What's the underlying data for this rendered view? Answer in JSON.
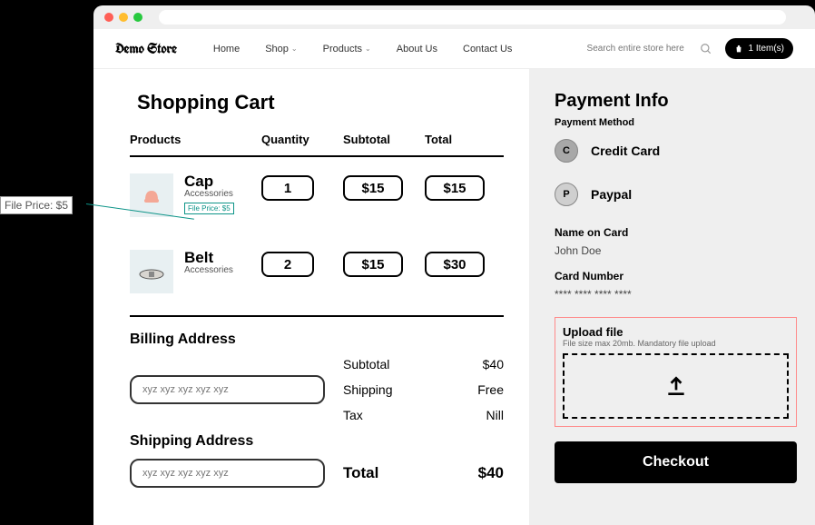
{
  "callout": {
    "label": "File Price: $5"
  },
  "store": {
    "name": "Demo Store"
  },
  "nav": {
    "home": "Home",
    "shop": "Shop",
    "products": "Products",
    "about": "About Us",
    "contact": "Contact Us",
    "search_placeholder": "Search entire store here ..",
    "cart_badge": "1 Item(s)"
  },
  "cart": {
    "title": "Shopping Cart",
    "headers": {
      "products": "Products",
      "quantity": "Quantity",
      "subtotal": "Subtotal",
      "total": "Total"
    },
    "items": [
      {
        "name": "Cap",
        "category": "Accessories",
        "file_price": "File Price: $5",
        "qty": "1",
        "subtotal": "$15",
        "total": "$15"
      },
      {
        "name": "Belt",
        "category": "Accessories",
        "qty": "2",
        "subtotal": "$15",
        "total": "$30"
      }
    ],
    "billing_title": "Billing Address",
    "shipping_title": "Shipping Address",
    "address_placeholder": "xyz xyz xyz xyz xyz",
    "summary": {
      "subtotal_label": "Subtotal",
      "subtotal_value": "$40",
      "shipping_label": "Shipping",
      "shipping_value": "Free",
      "tax_label": "Tax",
      "tax_value": "Nill",
      "total_label": "Total",
      "total_value": "$40"
    }
  },
  "payment": {
    "title": "Payment Info",
    "method_label": "Payment Method",
    "options": [
      {
        "letter": "C",
        "name": "Credit Card"
      },
      {
        "letter": "P",
        "name": "Paypal"
      }
    ],
    "name_label": "Name on Card",
    "name_value": "John Doe",
    "card_label": "Card Number",
    "card_value": "**** **** **** ****",
    "upload": {
      "title": "Upload file",
      "subtitle": "File size max 20mb. Mandatory file upload"
    },
    "checkout": "Checkout"
  }
}
